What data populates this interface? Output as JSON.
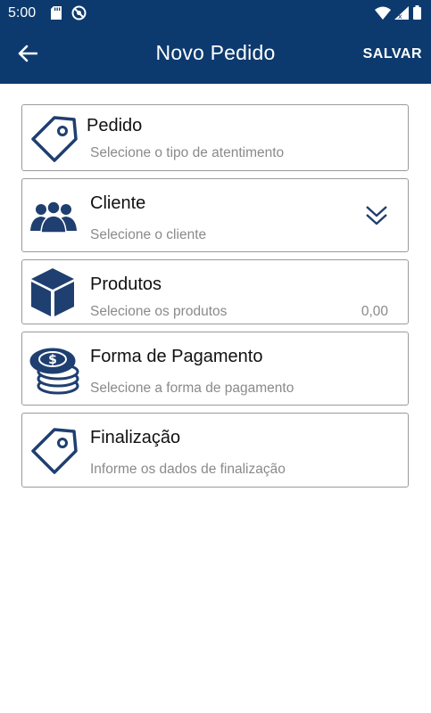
{
  "status_bar": {
    "time": "5:00"
  },
  "app_bar": {
    "title": "Novo Pedido",
    "save_label": "SALVAR"
  },
  "cards": [
    {
      "title": "Pedido",
      "subtitle": "Selecione o tipo de atentimento",
      "icon": "tag-icon"
    },
    {
      "title": "Cliente",
      "subtitle": "Selecione o cliente",
      "icon": "users-icon"
    },
    {
      "title": "Produtos",
      "subtitle": "Selecione os produtos",
      "value": "0,00",
      "icon": "box-icon"
    },
    {
      "title": "Forma de Pagamento",
      "subtitle": "Selecione a forma de pagamento",
      "icon": "coins-icon"
    },
    {
      "title": "Finalização",
      "subtitle": "Informe os dados de finalização",
      "icon": "tag-icon"
    }
  ],
  "colors": {
    "primary": "#0d3a6e",
    "icon": "#1f3f70"
  }
}
